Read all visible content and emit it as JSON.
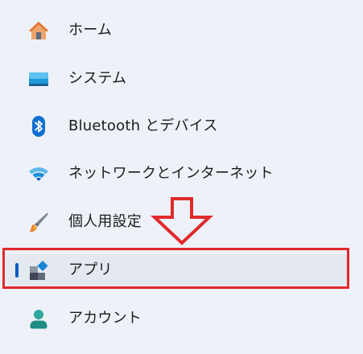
{
  "sidebar": {
    "items": [
      {
        "label": "ホーム",
        "icon": "home-icon"
      },
      {
        "label": "システム",
        "icon": "system-monitor-icon"
      },
      {
        "label": "Bluetooth とデバイス",
        "icon": "bluetooth-icon"
      },
      {
        "label": "ネットワークとインターネット",
        "icon": "wifi-icon"
      },
      {
        "label": "個人用設定",
        "icon": "paintbrush-icon"
      },
      {
        "label": "アプリ",
        "icon": "apps-icon"
      },
      {
        "label": "アカウント",
        "icon": "account-icon"
      }
    ],
    "selected": "アプリ"
  },
  "annotation": {
    "arrow": "down-arrow-icon",
    "box_color": "#e02a2a"
  },
  "colors": {
    "background": "#eef1f8",
    "selected_background": "#e4e8ef",
    "accent": "#0a5cc4"
  }
}
